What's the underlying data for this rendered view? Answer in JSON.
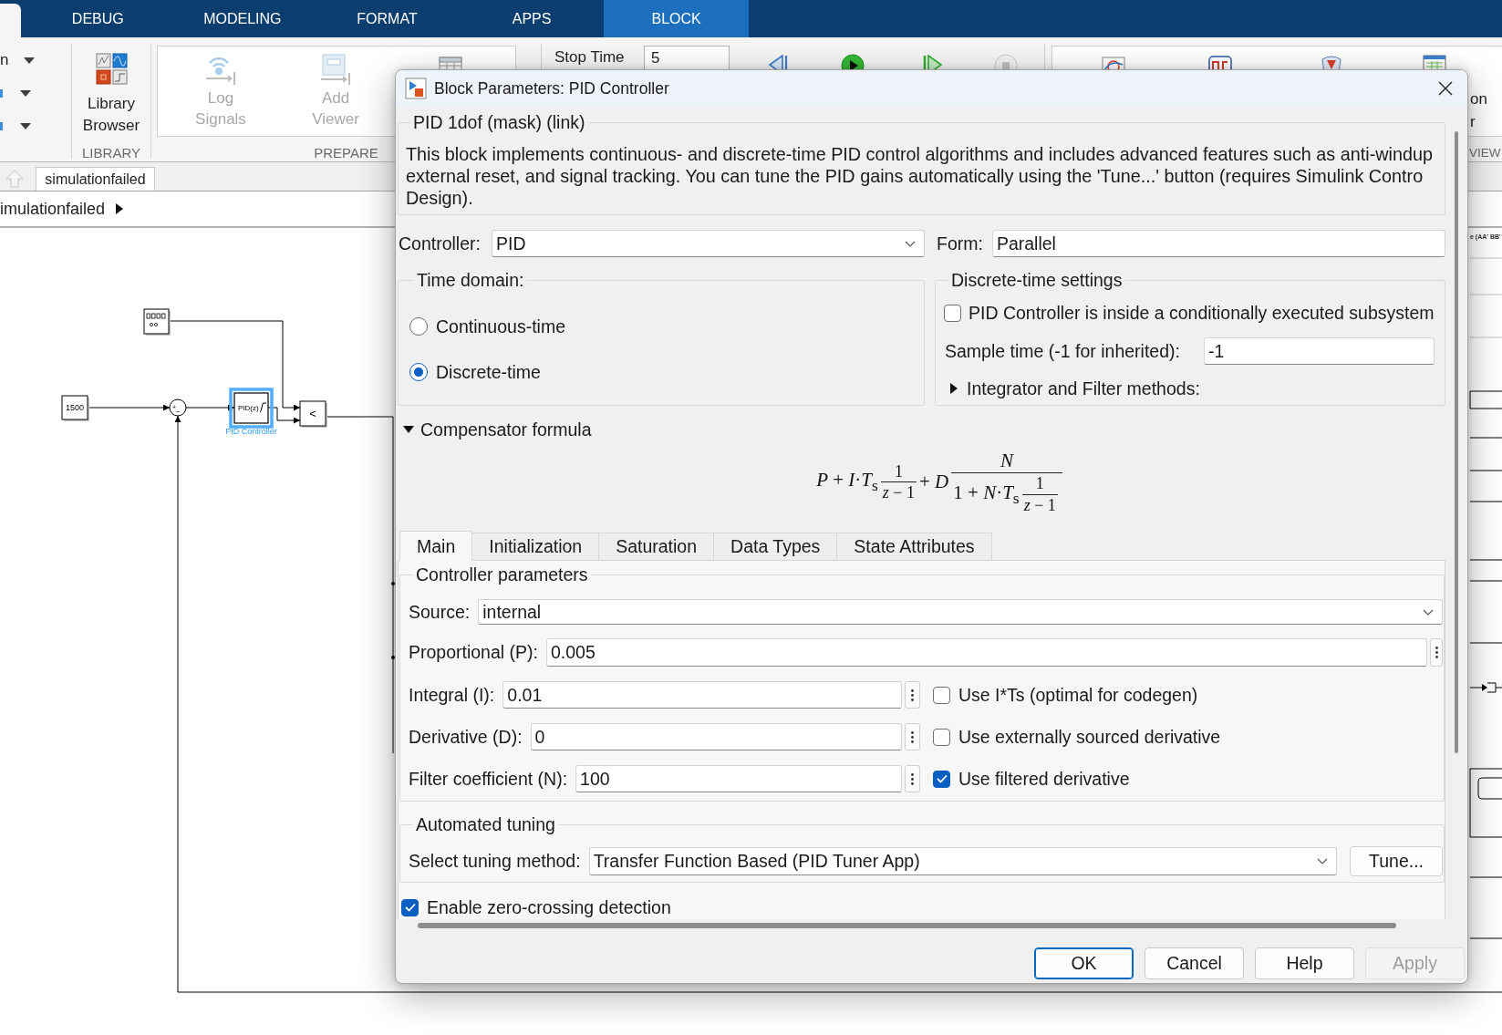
{
  "ribbon": {
    "tabs": [
      {
        "kind": "cut",
        "selected": true
      },
      {
        "kind": "standard",
        "label": "DEBUG",
        "selected": false
      },
      {
        "kind": "standard",
        "label": "MODELING",
        "selected": false
      },
      {
        "kind": "standard",
        "label": "FORMAT",
        "selected": false
      },
      {
        "kind": "standard",
        "label": "APPS",
        "selected": false
      },
      {
        "kind": "contextual",
        "label": "BLOCK",
        "selected": false
      }
    ],
    "quick_items": [
      {
        "kind": "text",
        "label": "n"
      },
      {
        "kind": "icon"
      },
      {
        "kind": "icon"
      }
    ],
    "library": {
      "button": "Library Browser",
      "title": "LIBRARY"
    },
    "prepare": {
      "buttons": [
        {
          "kind": "log",
          "label": "Log Signals",
          "disabled": true
        },
        {
          "kind": "viewer",
          "label": "Add Viewer",
          "disabled": true
        }
      ],
      "title": "PREPARE"
    },
    "simulate": {
      "stop_time": {
        "label": "Stop Time",
        "value": "5"
      }
    },
    "review": {
      "fragments": [
        "on",
        "r"
      ],
      "title": "VIEW"
    }
  },
  "model_tabs": [
    {
      "label": "simulationfailed",
      "selected": true
    }
  ],
  "breadcrumb": "imulationfailed",
  "diagram": {
    "blocks": [
      {
        "kind": "display",
        "selected": false
      },
      {
        "kind": "constant",
        "text": "1500",
        "selected": false
      },
      {
        "kind": "sum",
        "signs": [
          "+",
          "−"
        ],
        "selected": false
      },
      {
        "kind": "pid",
        "text": "PID(z)",
        "label": "PID Controller",
        "selected": true
      },
      {
        "kind": "relational",
        "text": "<",
        "selected": false
      }
    ],
    "fragment_label": "e (AA' BB'"
  },
  "dialog": {
    "title": "Block Parameters: PID Controller",
    "mask_title": "PID 1dof (mask) (link)",
    "description": [
      "This block implements continuous- and discrete-time PID control algorithms and includes advanced features such as anti-windup",
      "external reset, and signal tracking. You can tune the PID gains automatically using the 'Tune...' button (requires Simulink Contro",
      "Design)."
    ],
    "controller": {
      "label": "Controller:",
      "value": "PID"
    },
    "form": {
      "label": "Form:",
      "value": "Parallel"
    },
    "time_domain": {
      "title": "Time domain:",
      "options": [
        {
          "label": "Continuous-time",
          "selected": false
        },
        {
          "label": "Discrete-time",
          "selected": true
        }
      ]
    },
    "discrete_settings": {
      "title": "Discrete-time settings",
      "conditional": {
        "label": "PID Controller is inside a conditionally executed subsystem",
        "checked": false
      },
      "sample_time": {
        "label": "Sample time (-1 for inherited):",
        "value": "-1"
      },
      "methods": {
        "label": "Integrator and Filter methods:",
        "expanded": false
      }
    },
    "compensator": {
      "label": "Compensator formula",
      "expanded": true,
      "formula": {
        "lead": "*P* + *I*·*T*$_{s}$",
        "frac": {
          "num": "1",
          "den": "*z* − 1"
        },
        "mid": "+ *D*",
        "main": {
          "num": "*N*",
          "den_lead": "1 + *N*·*T*$_{s}$",
          "den_frac": {
            "num": "1",
            "den": "*z* − 1"
          }
        }
      }
    },
    "tabs": [
      {
        "label": "Main",
        "selected": true
      },
      {
        "label": "Initialization",
        "selected": false
      },
      {
        "label": "Saturation",
        "selected": false
      },
      {
        "label": "Data Types",
        "selected": false
      },
      {
        "label": "State Attributes",
        "selected": false
      }
    ],
    "controller_parameters": {
      "title": "Controller parameters",
      "source": {
        "label": "Source:",
        "value": "internal"
      },
      "gains": [
        {
          "label": "Proportional (P):",
          "value": "0.005"
        },
        {
          "label": "Integral (I):",
          "value": "0.01",
          "option": {
            "label": "Use I*Ts (optimal for codegen)",
            "checked": false
          }
        },
        {
          "label": "Derivative (D):",
          "value": "0",
          "option": {
            "label": "Use externally sourced derivative",
            "checked": false
          }
        },
        {
          "label": "Filter coefficient (N):",
          "value": "100",
          "option": {
            "label": "Use filtered derivative",
            "checked": true
          }
        }
      ]
    },
    "automated_tuning": {
      "title": "Automated tuning",
      "method": {
        "label": "Select tuning method:",
        "value": "Transfer Function Based (PID Tuner App)"
      },
      "tune_button": "Tune..."
    },
    "zero_crossing": {
      "label": "Enable zero-crossing detection",
      "checked": true
    },
    "buttons": [
      {
        "label": "OK",
        "default": true,
        "disabled": false
      },
      {
        "label": "Cancel",
        "default": false,
        "disabled": false
      },
      {
        "label": "Help",
        "default": false,
        "disabled": false
      },
      {
        "label": "Apply",
        "default": false,
        "disabled": true
      }
    ]
  }
}
